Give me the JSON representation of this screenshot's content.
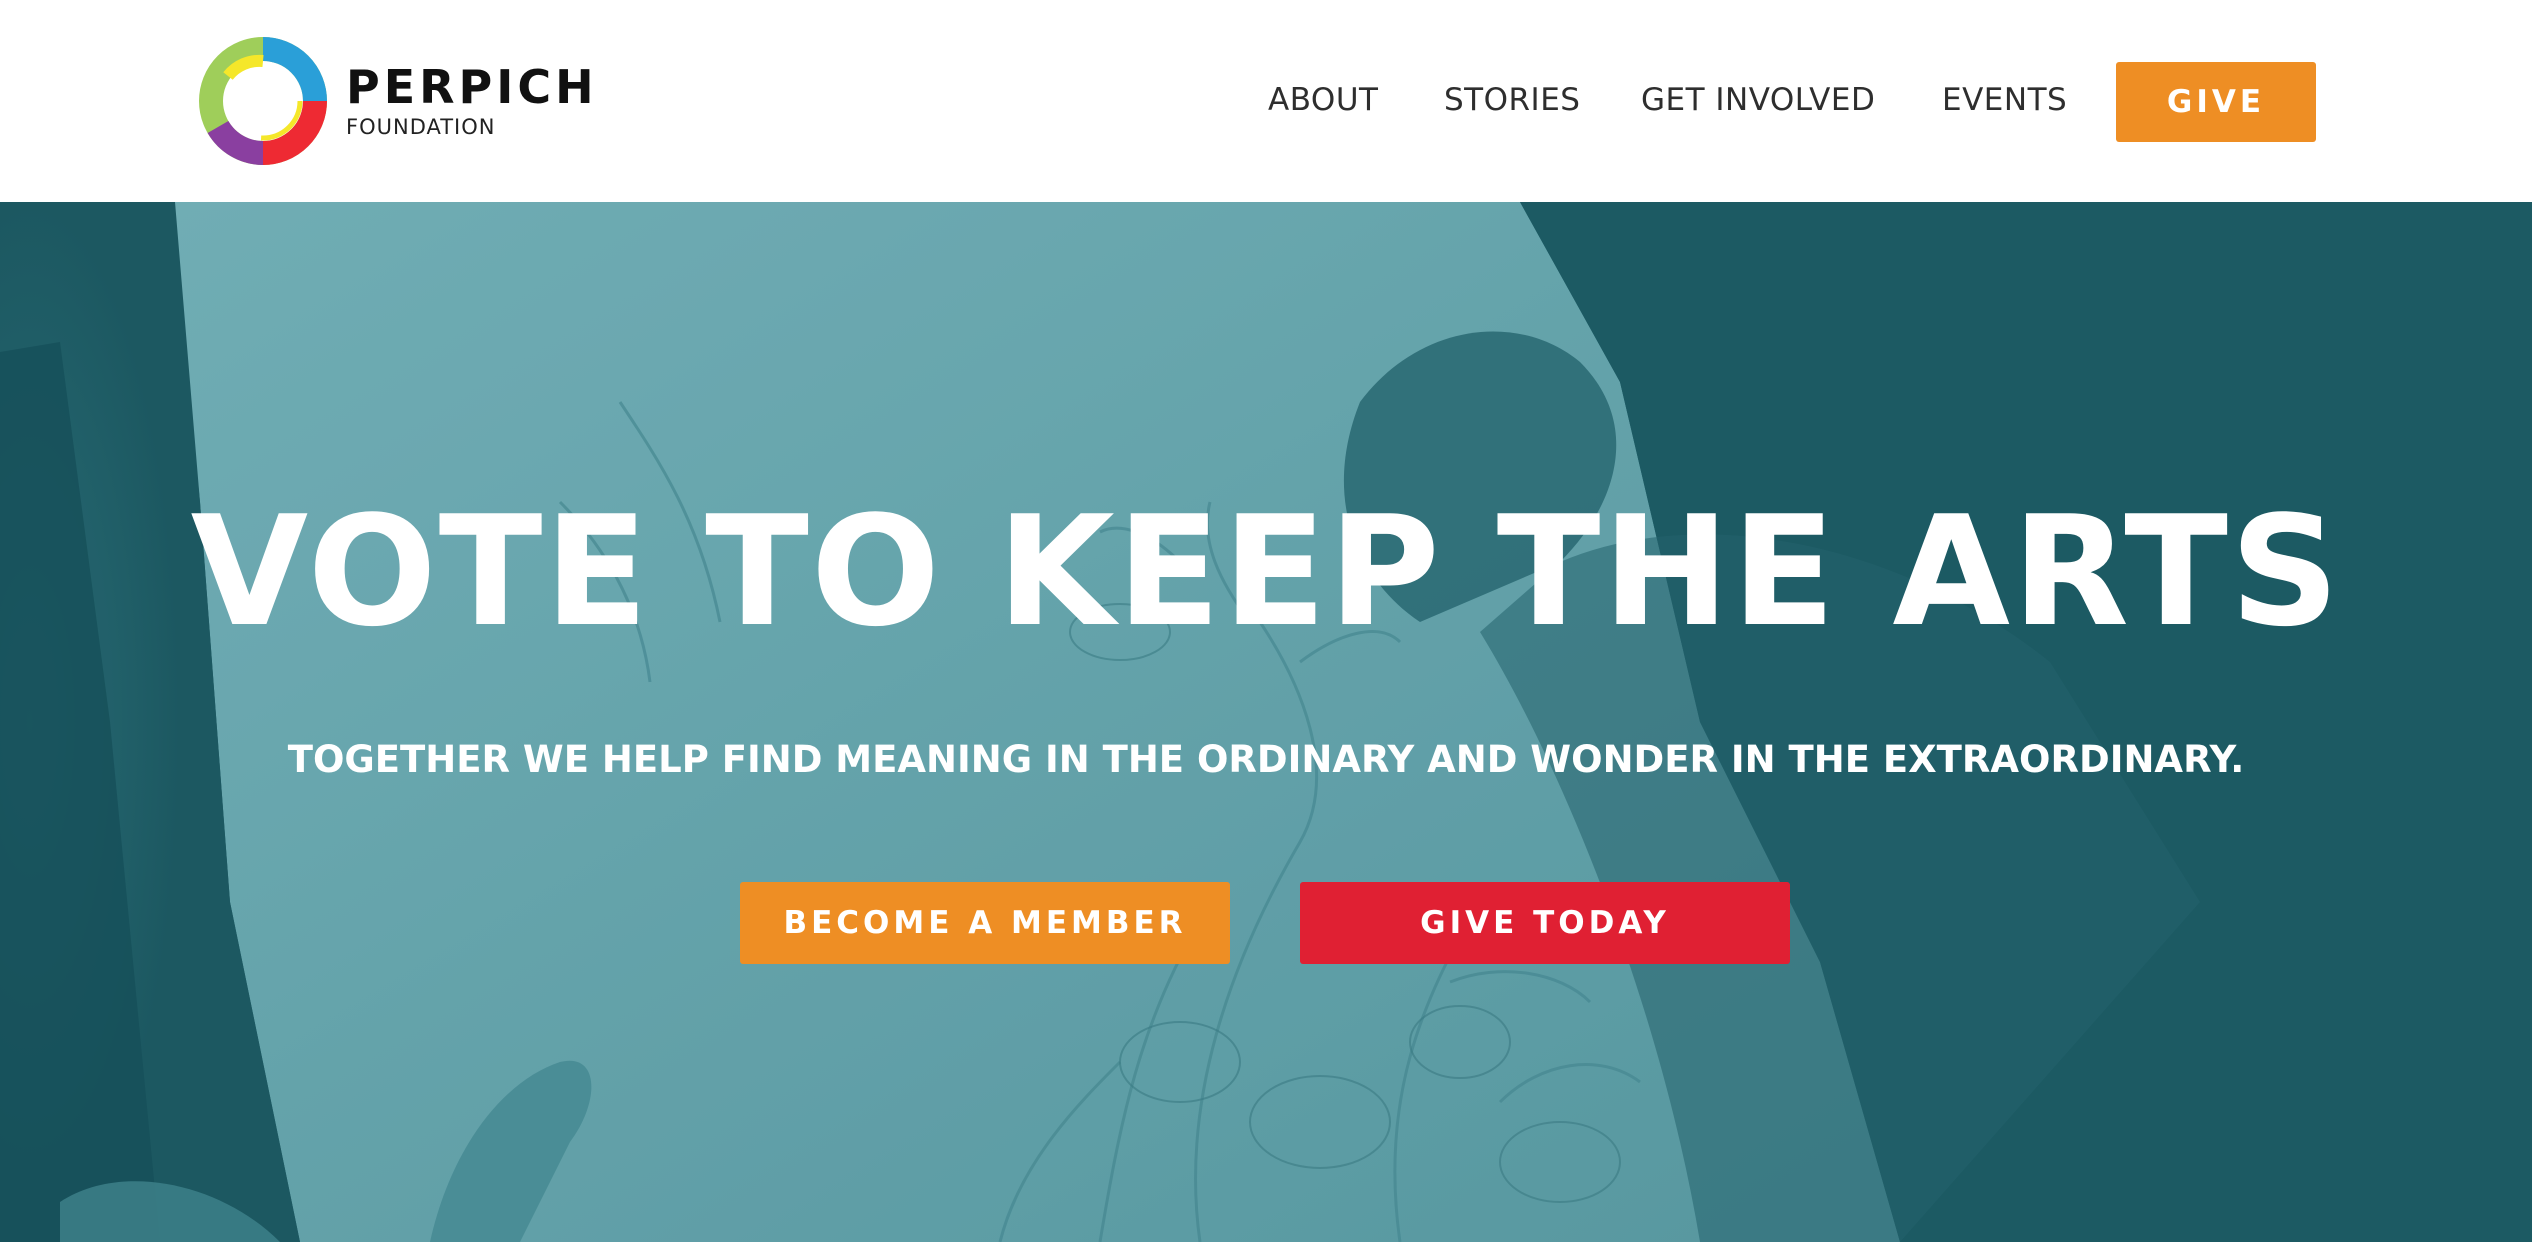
{
  "header": {
    "logo": {
      "name": "PERPICH",
      "subtitle": "FOUNDATION",
      "icon": "perpich-ring-logo-icon",
      "colors": [
        "#9fce5a",
        "#f5e72a",
        "#2a9fd8",
        "#ee2a33",
        "#8a3fa0"
      ]
    },
    "nav": {
      "items": [
        {
          "label": "ABOUT"
        },
        {
          "label": "STORIES"
        },
        {
          "label": "GET INVOLVED"
        },
        {
          "label": "EVENTS"
        }
      ],
      "give_label": "GIVE"
    }
  },
  "hero": {
    "title": "VOTE TO KEEP THE ARTS",
    "subtitle": "TOGETHER WE HELP FIND MEANING IN THE ORDINARY AND WONDER IN THE EXTRAORDINARY.",
    "buttons": {
      "member_label": "BECOME A MEMBER",
      "give_today_label": "GIVE TODAY"
    },
    "background_image": "artist-drawing-photo-teal-duotone"
  },
  "colors": {
    "accent_orange": "#ee8e24",
    "accent_red": "#e02033",
    "hero_teal_dark": "#1f5d66",
    "hero_teal_light": "#73b1b8",
    "nav_text": "#2e2e2e"
  }
}
